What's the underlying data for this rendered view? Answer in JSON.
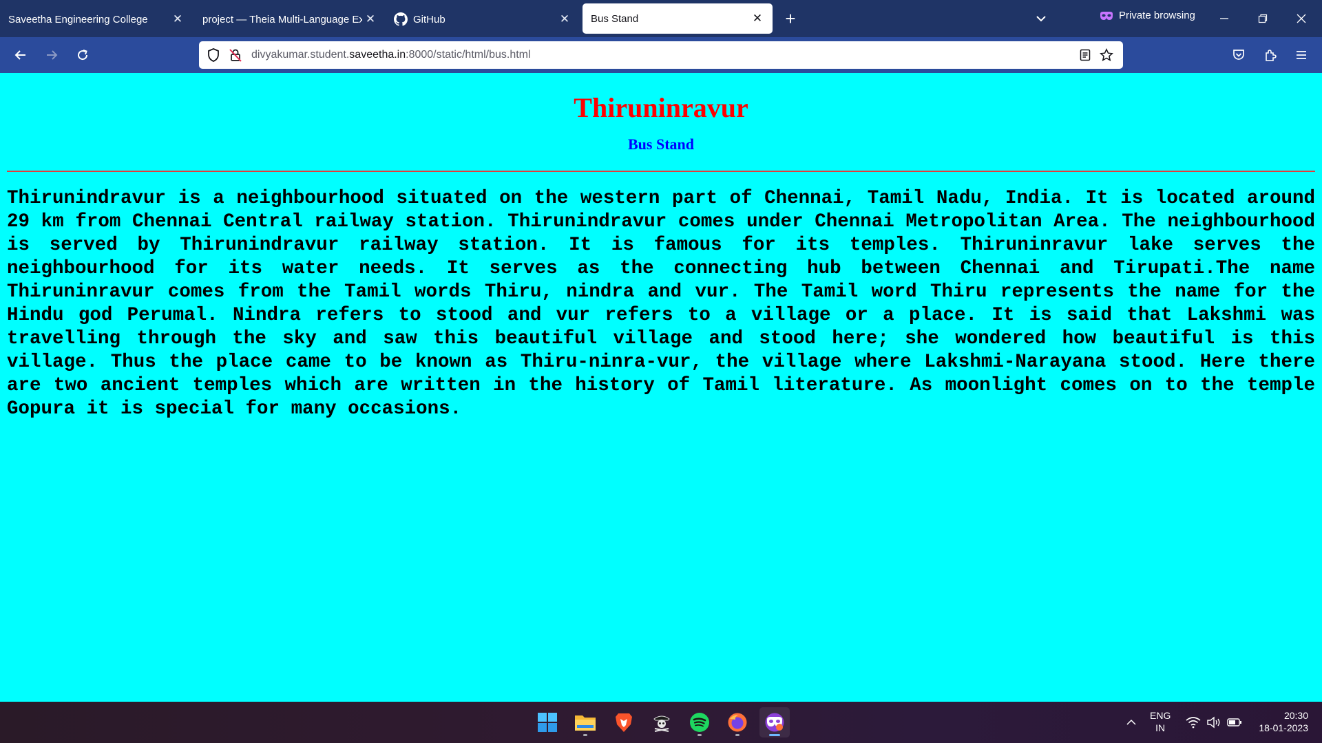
{
  "browser": {
    "tabs": [
      {
        "label": "Saveetha Engineering College",
        "active": false
      },
      {
        "label": "project — Theia Multi-Language Ex",
        "active": false
      },
      {
        "label": "GitHub",
        "active": false
      },
      {
        "label": "Bus Stand",
        "active": true
      }
    ],
    "private_label": "Private browsing",
    "url": {
      "subdomain": "divyakumar.student.",
      "host": "saveetha.in",
      "path": ":8000/static/html/bus.html"
    }
  },
  "page": {
    "title": "Thiruninravur",
    "subtitle": "Bus Stand",
    "body": "Thirunindravur is a neighbourhood situated on the western part of Chennai, Tamil Nadu, India. It is located around 29 km from Chennai Central railway station. Thirunindravur comes under Chennai Metropolitan Area. The neighbourhood is served by Thirunindravur railway station. It is famous for its temples. Thiruninravur lake serves the neighbourhood for its water needs. It serves as the connecting hub between Chennai and Tirupati.The name Thiruninravur comes from the Tamil words Thiru, nindra and vur. The Tamil word Thiru represents the name for the Hindu god Perumal. Nindra refers to stood and vur refers to a village or a place. It is said that Lakshmi was travelling through the sky and saw this beautiful village and stood here; she wondered how beautiful is this village. Thus the place came to be known as Thiru-ninra-vur, the village where Lakshmi-Narayana stood. Here there are two ancient temples which are written in the history of Tamil literature. As moonlight comes on to the temple Gopura it is special for many occasions.",
    "colors": {
      "background": "#00ffff",
      "title": "#ff0000",
      "subtitle": "#0000ff",
      "divider": "#e23c3c"
    }
  },
  "taskbar": {
    "apps": [
      "windows-start-icon",
      "file-explorer-icon",
      "brave-icon",
      "pirate-app-icon",
      "spotify-icon",
      "firefox-icon",
      "firefox-private-icon"
    ],
    "language": {
      "line1": "ENG",
      "line2": "IN"
    },
    "clock": {
      "time": "20:30",
      "date": "18-01-2023"
    }
  }
}
